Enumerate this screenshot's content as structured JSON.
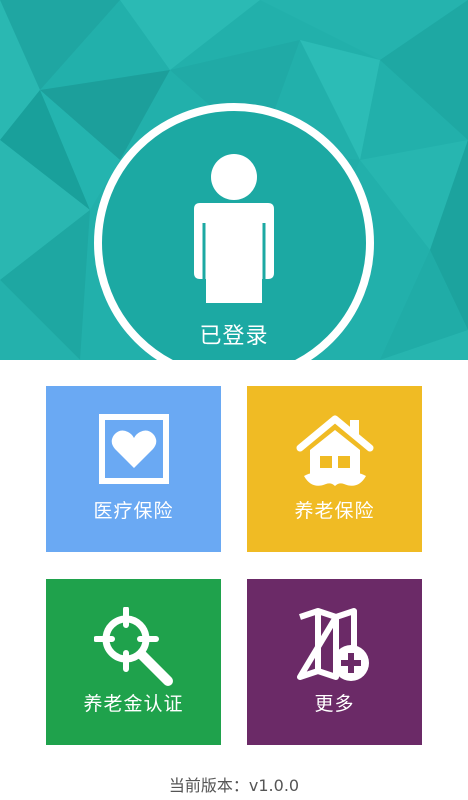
{
  "header": {
    "login_status": "已登录",
    "background_color": "#23b2ad",
    "avatar_icon": "person-icon"
  },
  "tiles": [
    {
      "label": "医疗保险",
      "color": "#6aa9f3",
      "icon": "heart-card-icon"
    },
    {
      "label": "养老保险",
      "color": "#f0bb24",
      "icon": "house-mustache-icon"
    },
    {
      "label": "养老金认证",
      "color": "#1fa24c",
      "icon": "target-search-icon"
    },
    {
      "label": "更多",
      "color": "#6b2a67",
      "icon": "map-plus-icon"
    }
  ],
  "footer": {
    "version_text": "当前版本：v1.0.0"
  }
}
